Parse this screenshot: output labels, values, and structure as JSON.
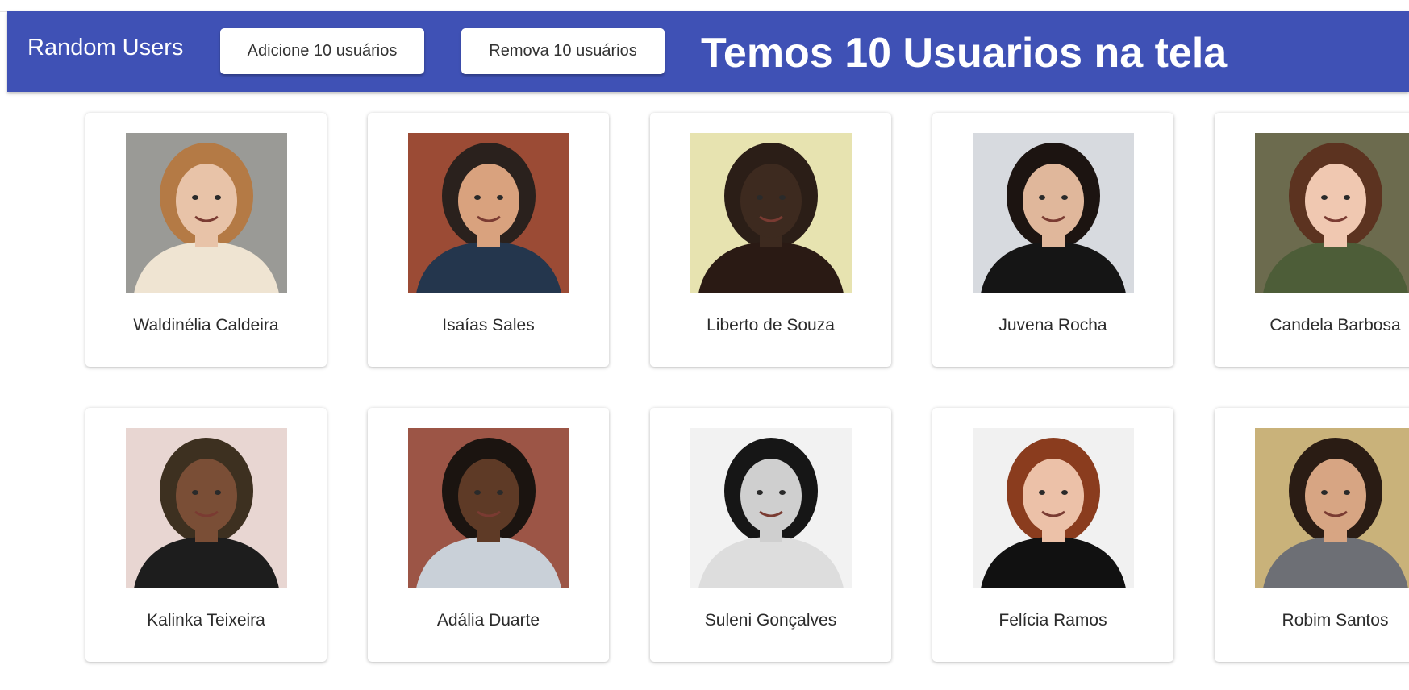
{
  "appbar": {
    "title": "Random Users",
    "add_button_label": "Adicione 10 usuários",
    "remove_button_label": "Remova 10 usuários",
    "headline": "Temos 10 Usuarios na tela",
    "color": "#3f51b5"
  },
  "users": [
    {
      "name": "Waldinélia Caldeira",
      "bg": "#9a9a96",
      "skin": "#e8c3a8",
      "hair": "#b47a45",
      "shirt": "#efe4d2"
    },
    {
      "name": "Isaías Sales",
      "bg": "#9b4b35",
      "skin": "#d9a27e",
      "hair": "#2a211d",
      "shirt": "#24364d"
    },
    {
      "name": "Liberto de Souza",
      "bg": "#e7e3b0",
      "skin": "#3d2a1f",
      "hair": "#2b1e17",
      "shirt": "#2a1a14"
    },
    {
      "name": "Juvena Rocha",
      "bg": "#d7dadf",
      "skin": "#e0b79b",
      "hair": "#1c1411",
      "shirt": "#151515"
    },
    {
      "name": "Candela Barbosa",
      "bg": "#6c6b4e",
      "skin": "#f0c8b1",
      "hair": "#5c3320",
      "shirt": "#4d5d38"
    },
    {
      "name": "Kalinka Teixeira",
      "bg": "#e8d6d2",
      "skin": "#7a4e36",
      "hair": "#3d3020",
      "shirt": "#1d1d1d"
    },
    {
      "name": "Adália Duarte",
      "bg": "#9c5546",
      "skin": "#5e3a26",
      "hair": "#1b1410",
      "shirt": "#c9d0d8"
    },
    {
      "name": "Suleni Gonçalves",
      "bg": "#f2f2f2",
      "skin": "#cfcfcf",
      "hair": "#161616",
      "shirt": "#dddddd"
    },
    {
      "name": "Felícia Ramos",
      "bg": "#f1f1f1",
      "skin": "#ecc1a8",
      "hair": "#8a3c1e",
      "shirt": "#111111"
    },
    {
      "name": "Robim Santos",
      "bg": "#c9b27a",
      "skin": "#d7a583",
      "hair": "#2a1c14",
      "shirt": "#6d6f75"
    }
  ]
}
